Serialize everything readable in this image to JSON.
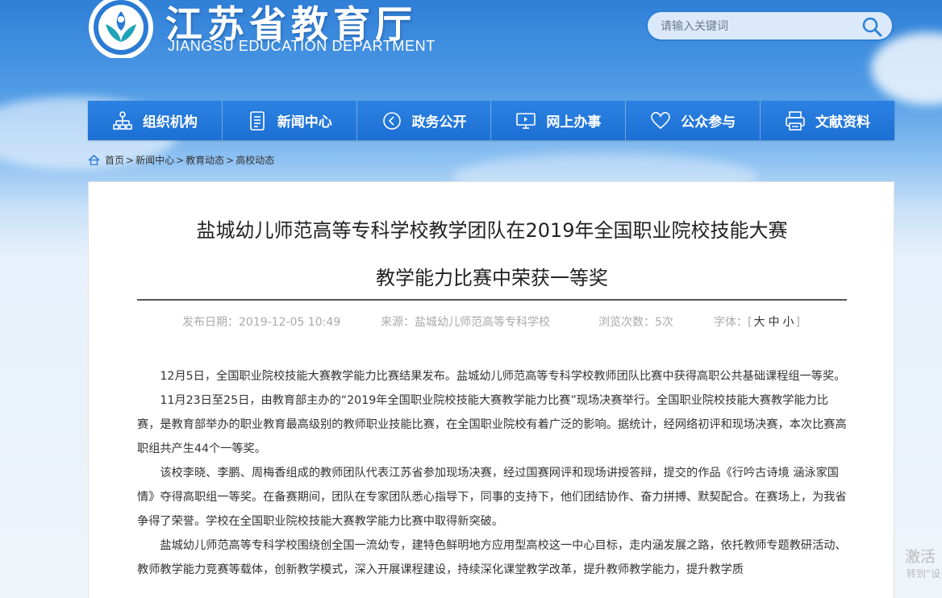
{
  "header": {
    "title": "江苏省教育厅",
    "subtitle": "JIANGSU EDUCATION DEPARTMENT",
    "logo_icon": "education-department-emblem",
    "search_placeholder": "请输入关键词"
  },
  "nav": [
    {
      "label": "组织机构",
      "icon": "org-chart-icon"
    },
    {
      "label": "新闻中心",
      "icon": "document-icon"
    },
    {
      "label": "政务公开",
      "icon": "play-circle-icon"
    },
    {
      "label": "网上办事",
      "icon": "monitor-icon"
    },
    {
      "label": "公众参与",
      "icon": "heart-icon"
    },
    {
      "label": "文献资料",
      "icon": "printer-icon"
    }
  ],
  "breadcrumb": [
    "首页",
    "新闻中心",
    "教育动态",
    "高校动态"
  ],
  "article": {
    "title_line1": "盐城幼儿师范高等专科学校教学团队在2019年全国职业院校技能大赛",
    "title_line2": "教学能力比赛中荣获一等奖",
    "date": "发布日期：2019-12-05 10:49",
    "source": "来源：盐城幼儿师范高等专科学校",
    "views": "浏览次数：5次",
    "font_label": "字体：",
    "font_sizes": [
      "大",
      "中",
      "小"
    ],
    "paragraphs": [
      "12月5日，全国职业院校技能大赛教学能力比赛结果发布。盐城幼儿师范高等专科学校教师团队比赛中获得高职公共基础课程组一等奖。",
      "11月23日至25日，由教育部主办的“2019年全国职业院校技能大赛教学能力比赛”现场决赛举行。全国职业院校技能大赛教学能力比赛，是教育部举办的职业教育最高级别的教师职业技能比赛，在全国职业院校有着广泛的影响。据统计，经网络初评和现场决赛，本次比赛高职组共产生44个一等奖。",
      "该校李晓、李鹏、周梅香组成的教师团队代表江苏省参加现场决赛，经过国赛网评和现场讲授答辩，提交的作品《行吟古诗境 涵泳家国情》夺得高职组一等奖。在备赛期间，团队在专家团队悉心指导下，同事的支持下，他们团结协作、奋力拼搏、默契配合。在赛场上，为我省争得了荣誉。学校在全国职业院校技能大赛教学能力比赛中取得新突破。",
      "盐城幼儿师范高等专科学校围绕创全国一流幼专，建特色鲜明地方应用型高校这一中心目标，走内涵发展之路，依托教师专题教研活动、教师教学能力竞赛等载体，创新教学模式，深入开展课程建设，持续深化课堂教学改革，提升教师教学能力，提升教学质"
    ]
  },
  "watermark": {
    "line1": "激活",
    "line2": "转到“设"
  },
  "colors": {
    "nav_bg": "#1f74d8",
    "search_border": "#2b7fd6"
  }
}
